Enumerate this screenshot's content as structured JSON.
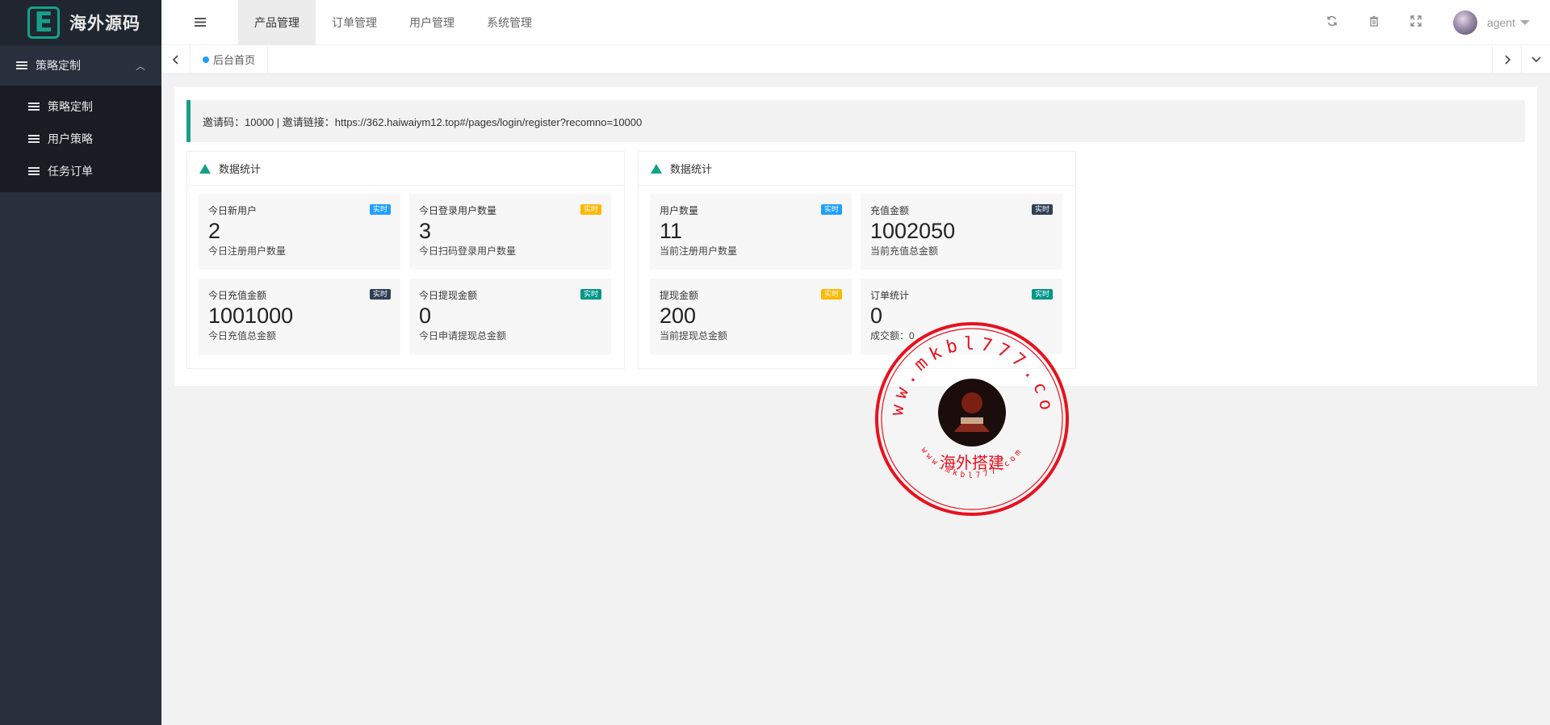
{
  "app": {
    "logo_letter": "E",
    "logo_text": "海外源码"
  },
  "sidebar": {
    "group_label": "策略定制",
    "items": [
      {
        "label": "策略定制"
      },
      {
        "label": "用户策略"
      },
      {
        "label": "任务订单"
      }
    ]
  },
  "header": {
    "nav": [
      {
        "label": "产品管理",
        "active": true
      },
      {
        "label": "订单管理"
      },
      {
        "label": "用户管理"
      },
      {
        "label": "系统管理"
      }
    ],
    "user": "agent",
    "icons": [
      "refresh-icon",
      "trash-icon",
      "fullscreen-icon"
    ]
  },
  "tabs": {
    "home_label": "后台首页"
  },
  "notice": {
    "text": "邀请码：10000 | 邀请链接：https://362.haiwaiym12.top#/pages/login/register?recomno=10000"
  },
  "panels": [
    {
      "title": "数据统计",
      "stats": [
        {
          "label": "今日新用户",
          "value": "2",
          "sub": "今日注册用户数量",
          "badge": "实时",
          "badge_color": "#1e9fff"
        },
        {
          "label": "今日登录用户数量",
          "value": "3",
          "sub": "今日扫码登录用户数量",
          "badge": "实时",
          "badge_color": "#ffb800"
        },
        {
          "label": "今日充值金额",
          "value": "1001000",
          "sub": "今日充值总金额",
          "badge": "实时",
          "badge_color": "#2f4056"
        },
        {
          "label": "今日提现金额",
          "value": "0",
          "sub": "今日申请提现总金额",
          "badge": "实时",
          "badge_color": "#009688"
        }
      ]
    },
    {
      "title": "数据统计",
      "stats": [
        {
          "label": "用户数量",
          "value": "11",
          "sub": "当前注册用户数量",
          "badge": "实时",
          "badge_color": "#1e9fff"
        },
        {
          "label": "充值金额",
          "value": "1002050",
          "sub": "当前充值总金额",
          "badge": "实时",
          "badge_color": "#2f4056"
        },
        {
          "label": "提现金额",
          "value": "200",
          "sub": "当前提现总金额",
          "badge": "实时",
          "badge_color": "#ffb800"
        },
        {
          "label": "订单统计",
          "value": "0",
          "sub": "成交额：0",
          "badge": "实时",
          "badge_color": "#009688"
        }
      ]
    }
  ],
  "watermark": {
    "url_text": "www.mkbl777.com",
    "center_text": "海外搭建",
    "inner_url": "www.mkbl777.com"
  }
}
